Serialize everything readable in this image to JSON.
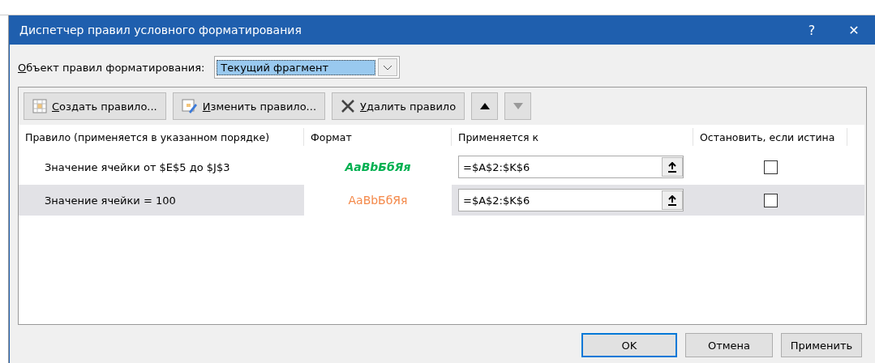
{
  "window": {
    "title": "Диспетчер правил условного форматирования",
    "help": "?",
    "close": "✕"
  },
  "scope": {
    "label": "Объект правил форматирования:",
    "accesskey": true,
    "value": "Текущий фрагмент"
  },
  "toolbar": [
    {
      "kind": "new",
      "label": "Создать правило...",
      "accesskey": true,
      "disabled": false
    },
    {
      "kind": "edit",
      "label": "Изменить правило...",
      "accesskey": true,
      "disabled": false
    },
    {
      "kind": "delete",
      "label": "Удалить правило",
      "accesskey": true,
      "disabled": false
    },
    {
      "kind": "up",
      "disabled": false
    },
    {
      "kind": "down",
      "disabled": true
    }
  ],
  "table": {
    "columns": [
      "Правило (применяется в указанном порядке)",
      "Формат",
      "Применяется к",
      "Остановить, если истина"
    ],
    "rows": [
      {
        "rule": "Значение ячейки от $E$5 до $J$3",
        "format": {
          "sample": "AaBbБбЯя",
          "color": "#00b050",
          "bold": true,
          "italic": true
        },
        "applies_to": "=$A$2:$K$6",
        "stop": false,
        "selected": false
      },
      {
        "rule": "Значение ячейки = 100",
        "format": {
          "sample": "AaBbБбЯя",
          "color": "#f4894a",
          "bold": false,
          "italic": false
        },
        "applies_to": "=$A$2:$K$6",
        "stop": false,
        "selected": true
      }
    ]
  },
  "buttons": [
    {
      "label": "OK",
      "default": true
    },
    {
      "label": "Отмена",
      "default": false
    },
    {
      "label": "Применить",
      "default": false
    }
  ]
}
